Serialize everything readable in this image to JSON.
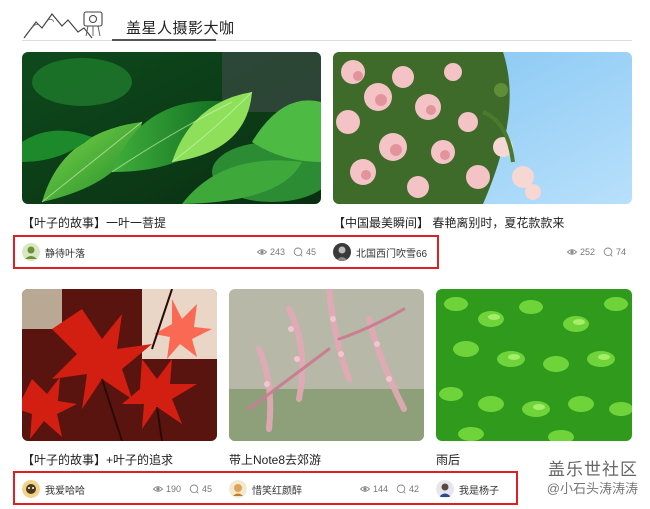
{
  "header": {
    "title": "盖星人摄影大咖"
  },
  "cards": [
    {
      "caption": "【叶子的故事】一叶一菩提",
      "author": "静待叶落",
      "views": "243",
      "comments": "45"
    },
    {
      "caption": "【中国最美瞬间】 春艳离别时，夏花款款来",
      "author": "北国西门吹雪66",
      "views": "252",
      "comments": "74"
    },
    {
      "caption": "【叶子的故事】+叶子的追求",
      "author": "我爱哈哈",
      "views": "190",
      "comments": "45"
    },
    {
      "caption": "带上Note8去郊游",
      "author": "惜笑红颜醉",
      "views": "144",
      "comments": "42"
    },
    {
      "caption": "雨后",
      "author": "我是杨子",
      "views": "",
      "comments": ""
    }
  ],
  "watermark": {
    "line1": "盖乐世社区",
    "line2": "@小石头涛涛涛"
  },
  "icons": {
    "views": "eye-icon",
    "comments": "comment-bubble-icon"
  },
  "colors": {
    "highlight": "#e02020"
  }
}
